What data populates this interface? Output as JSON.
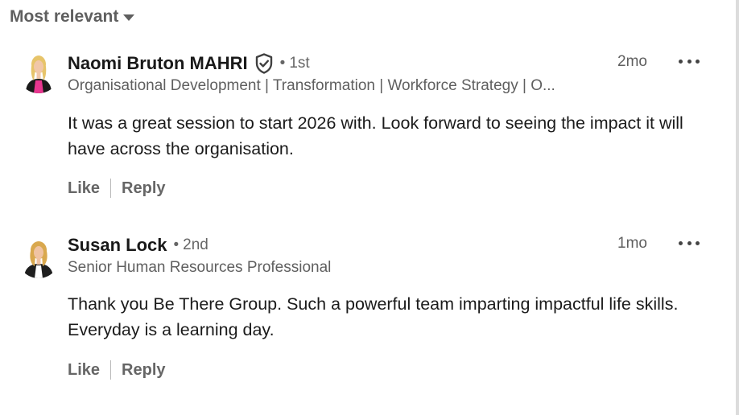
{
  "sort": {
    "label": "Most relevant",
    "icon": "caret-down-icon"
  },
  "comments": [
    {
      "author": "Naomi Bruton MAHRI",
      "verified": true,
      "degree": "1st",
      "headline": "Organisational Development | Transformation | Workforce Strategy | O...",
      "time": "2mo",
      "text": "It was a great session to start 2026 with. Look forward to seeing the impact it will have across the organisation.",
      "like_label": "Like",
      "reply_label": "Reply",
      "avatar_colors": {
        "hair": "#e7c46a",
        "top": "#e8368f",
        "jacket": "#1a1a1a",
        "skin": "#f1c7a8"
      }
    },
    {
      "author": "Susan Lock",
      "verified": false,
      "degree": "2nd",
      "headline": "Senior Human Resources Professional",
      "time": "1mo",
      "text": "Thank you Be There Group. Such a powerful team imparting impactful life skills. Everyday is a learning day.",
      "like_label": "Like",
      "reply_label": "Reply",
      "avatar_colors": {
        "hair": "#d9a84e",
        "top": "#ffffff",
        "jacket": "#1e1e1e",
        "skin": "#f0c3a2"
      }
    }
  ],
  "bullet": "•",
  "colors": {
    "name": "#191919",
    "meta": "#5f5f5f",
    "body": "#1b1b1b"
  }
}
